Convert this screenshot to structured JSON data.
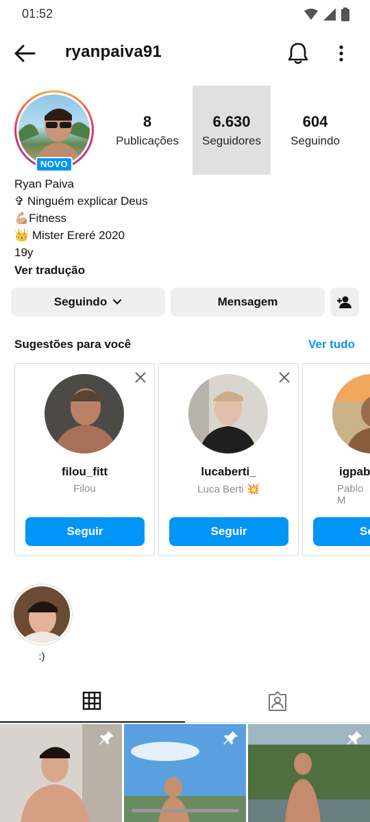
{
  "status_bar": {
    "time": "01:52",
    "icons": [
      "wifi-icon",
      "signal-icon",
      "battery-icon"
    ]
  },
  "header": {
    "username": "ryanpaiva91",
    "icons": [
      "back-arrow-icon",
      "bell-icon",
      "more-vertical-icon"
    ]
  },
  "profile": {
    "badge": "NOVO",
    "stats": [
      {
        "value": "8",
        "label": "Publicações"
      },
      {
        "value": "6.630",
        "label": "Seguidores"
      },
      {
        "value": "604",
        "label": "Seguindo"
      }
    ],
    "name": "Ryan Paiva",
    "bio_lines": [
      "✞ Ninguém explicar Deus",
      "💪🏼Fitness",
      "👑 Mister Ereré 2020",
      "19y"
    ],
    "translate": "Ver tradução"
  },
  "actions": {
    "following": "Seguindo",
    "message": "Mensagem"
  },
  "suggestions": {
    "title": "Sugestões para você",
    "see_all": "Ver tudo",
    "cards": [
      {
        "handle": "filou_fitt",
        "name": "Filou",
        "button": "Seguir"
      },
      {
        "handle": "lucaberti_",
        "name": "Luca Berti 💥",
        "button": "Seguir"
      },
      {
        "handle": "igpab",
        "name": "Pablo M",
        "button": "Seg"
      }
    ]
  },
  "highlights": [
    {
      "label": ":)"
    }
  ],
  "colors": {
    "accent": "#0095f6",
    "button_bg": "#efefef",
    "highlight_bg": "#e0e0e0"
  }
}
